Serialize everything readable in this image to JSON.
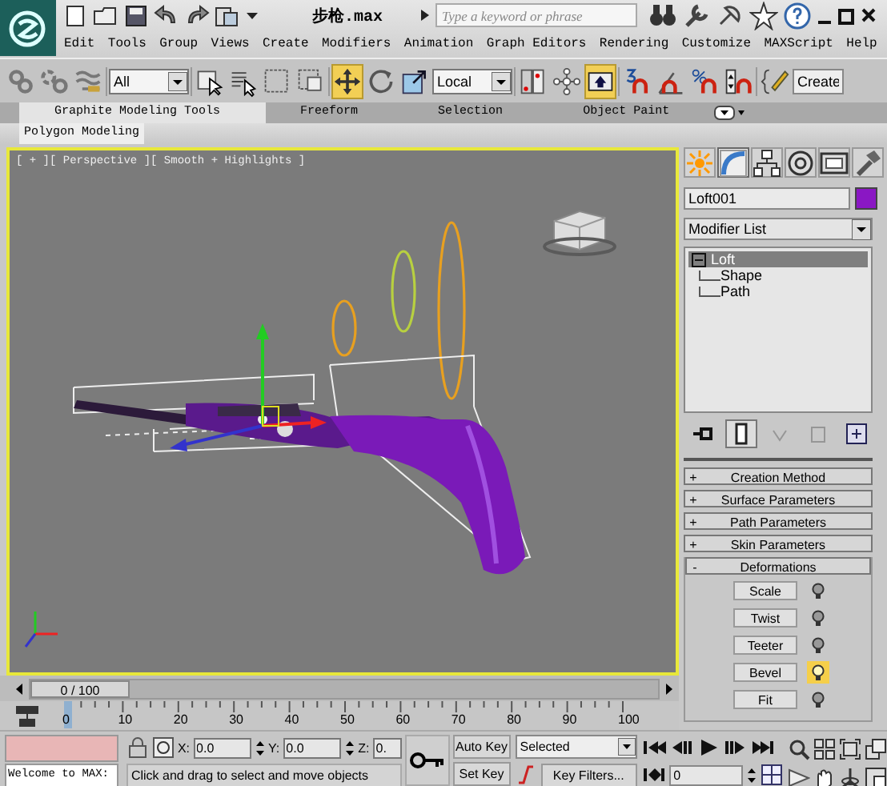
{
  "title": "步枪.max",
  "search": {
    "placeholder": "Type a keyword or phrase"
  },
  "menu": [
    "Edit",
    "Tools",
    "Group",
    "Views",
    "Create",
    "Modifiers",
    "Animation",
    "Graph Editors",
    "Rendering",
    "Customize",
    "MAXScript",
    "Help"
  ],
  "toolbar": [
    {
      "kind": "link",
      "active": false
    },
    {
      "kind": "unlink",
      "active": false
    },
    {
      "kind": "bind",
      "active": false
    },
    {
      "kind": "dropdown",
      "value": "All"
    },
    {
      "kind": "select",
      "active": false
    },
    {
      "kind": "select-name",
      "active": false
    },
    {
      "kind": "region",
      "active": false
    },
    {
      "kind": "crossing",
      "active": false
    },
    {
      "kind": "move",
      "active": true
    },
    {
      "kind": "rotate",
      "active": false
    },
    {
      "kind": "scale",
      "active": false
    },
    {
      "kind": "dropdown",
      "value": "Local"
    },
    {
      "kind": "pivot",
      "active": false
    },
    {
      "kind": "manipulate",
      "active": false
    },
    {
      "kind": "keyboard",
      "active": true
    },
    {
      "kind": "snap",
      "active": false
    },
    {
      "kind": "angle",
      "active": false
    },
    {
      "kind": "percent",
      "active": false
    },
    {
      "kind": "spinner",
      "active": false
    },
    {
      "kind": "named",
      "active": false
    },
    {
      "kind": "field",
      "value": "Create"
    }
  ],
  "ribbon": {
    "tabs": [
      {
        "label": "Graphite Modeling Tools",
        "selected": true
      },
      {
        "label": "Freeform",
        "selected": false
      },
      {
        "label": "Selection",
        "selected": false
      },
      {
        "label": "Object Paint",
        "selected": false
      }
    ],
    "panel": "Polygon Modeling"
  },
  "viewport": {
    "label": "[ + ][ Perspective ][ Smooth + Highlights ]"
  },
  "command_panel": {
    "tabs": [
      {
        "kind": "create",
        "selected": false
      },
      {
        "kind": "modify",
        "selected": true
      },
      {
        "kind": "hierarchy",
        "selected": false
      },
      {
        "kind": "motion",
        "selected": false
      },
      {
        "kind": "display",
        "selected": false
      },
      {
        "kind": "utilities",
        "selected": false
      }
    ],
    "object": {
      "name": "Loft001",
      "color": "#8a17c4"
    },
    "modifier_list": "Modifier List",
    "stack": [
      {
        "label": "Loft",
        "selected": true,
        "expanded": true,
        "children": [
          {
            "label": "Shape"
          },
          {
            "label": "Path"
          }
        ]
      }
    ],
    "stack_tools": [
      {
        "kind": "pin",
        "active": false,
        "disabled": false
      },
      {
        "kind": "end-result",
        "active": true,
        "disabled": false
      },
      {
        "kind": "unique",
        "active": false,
        "disabled": true
      },
      {
        "kind": "remove",
        "active": false,
        "disabled": true
      },
      {
        "kind": "configure",
        "active": false,
        "disabled": false
      }
    ],
    "rollouts": [
      {
        "toggle": "+",
        "label": "Creation Method",
        "expanded": false
      },
      {
        "toggle": "+",
        "label": "Surface Parameters",
        "expanded": false
      },
      {
        "toggle": "+",
        "label": "Path Parameters",
        "expanded": false
      },
      {
        "toggle": "+",
        "label": "Skin Parameters",
        "expanded": false
      },
      {
        "toggle": "-",
        "label": "Deformations",
        "expanded": true,
        "buttons": [
          {
            "label": "Scale",
            "on": false
          },
          {
            "label": "Twist",
            "on": false
          },
          {
            "label": "Teeter",
            "on": false
          },
          {
            "label": "Bevel",
            "on": true
          },
          {
            "label": "Fit",
            "on": false
          }
        ]
      }
    ]
  },
  "time_slider": {
    "label": "0 / 100"
  },
  "track_labels": [
    "0",
    "10",
    "20",
    "30",
    "40",
    "50",
    "60",
    "70",
    "80",
    "90",
    "100"
  ],
  "status": {
    "welcome": "Welcome to MAX:",
    "coordinates": [
      {
        "label": "X:",
        "value": "0.0"
      },
      {
        "label": "Y:",
        "value": "0.0"
      },
      {
        "label": "Z:",
        "value": "0."
      }
    ],
    "prompt": "Click and drag to select and move objects"
  },
  "animation": {
    "auto_key": "Auto Key",
    "set_key": "Set Key",
    "key_mode": "Selected",
    "key_filters": "Key Filters...",
    "current_frame": "0"
  }
}
